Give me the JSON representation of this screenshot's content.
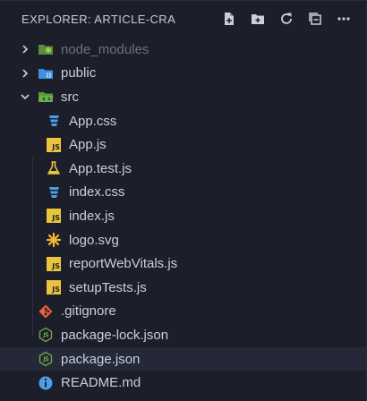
{
  "header": {
    "title": "EXPLORER: ARTICLE-CRA"
  },
  "tree": {
    "node_modules": "node_modules",
    "public": "public",
    "src": "src",
    "src_files": [
      "App.css",
      "App.js",
      "App.test.js",
      "index.css",
      "index.js",
      "logo.svg",
      "reportWebVitals.js",
      "setupTests.js"
    ],
    "root_files": [
      ".gitignore",
      "package-lock.json",
      "package.json",
      "README.md"
    ]
  },
  "icons": {
    "js_badge": "JS"
  },
  "colors": {
    "background": "#1c1e2a",
    "selected_row": "#242838",
    "js_yellow": "#e9c53b",
    "css_blue": "#4a9fe8",
    "node_green": "#6da544",
    "git_orange": "#e8643a",
    "info_blue": "#4a9fe8",
    "folder_green": "#6ab04c",
    "folder_blue": "#3d8fe0"
  }
}
